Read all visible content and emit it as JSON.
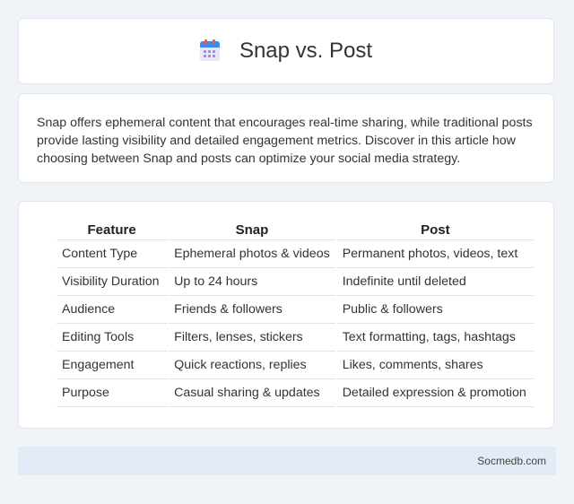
{
  "header": {
    "title": "Snap vs. Post",
    "icon": "calendar-icon"
  },
  "intro": {
    "text": "Snap offers ephemeral content that encourages real-time sharing, while traditional posts provide lasting visibility and detailed engagement metrics. Discover in this article how choosing between Snap and posts can optimize your social media strategy."
  },
  "table": {
    "headers": [
      "Feature",
      "Snap",
      "Post"
    ],
    "rows": [
      [
        "Content Type",
        "Ephemeral photos & videos",
        "Permanent photos, videos, text"
      ],
      [
        "Visibility Duration",
        "Up to 24 hours",
        "Indefinite until deleted"
      ],
      [
        "Audience",
        "Friends & followers",
        "Public & followers"
      ],
      [
        "Editing Tools",
        "Filters, lenses, stickers",
        "Text formatting, tags, hashtags"
      ],
      [
        "Engagement",
        "Quick reactions, replies",
        "Likes, comments, shares"
      ],
      [
        "Purpose",
        "Casual sharing & updates",
        "Detailed expression & promotion"
      ]
    ]
  },
  "footer": {
    "text": "Socmedb.com"
  }
}
